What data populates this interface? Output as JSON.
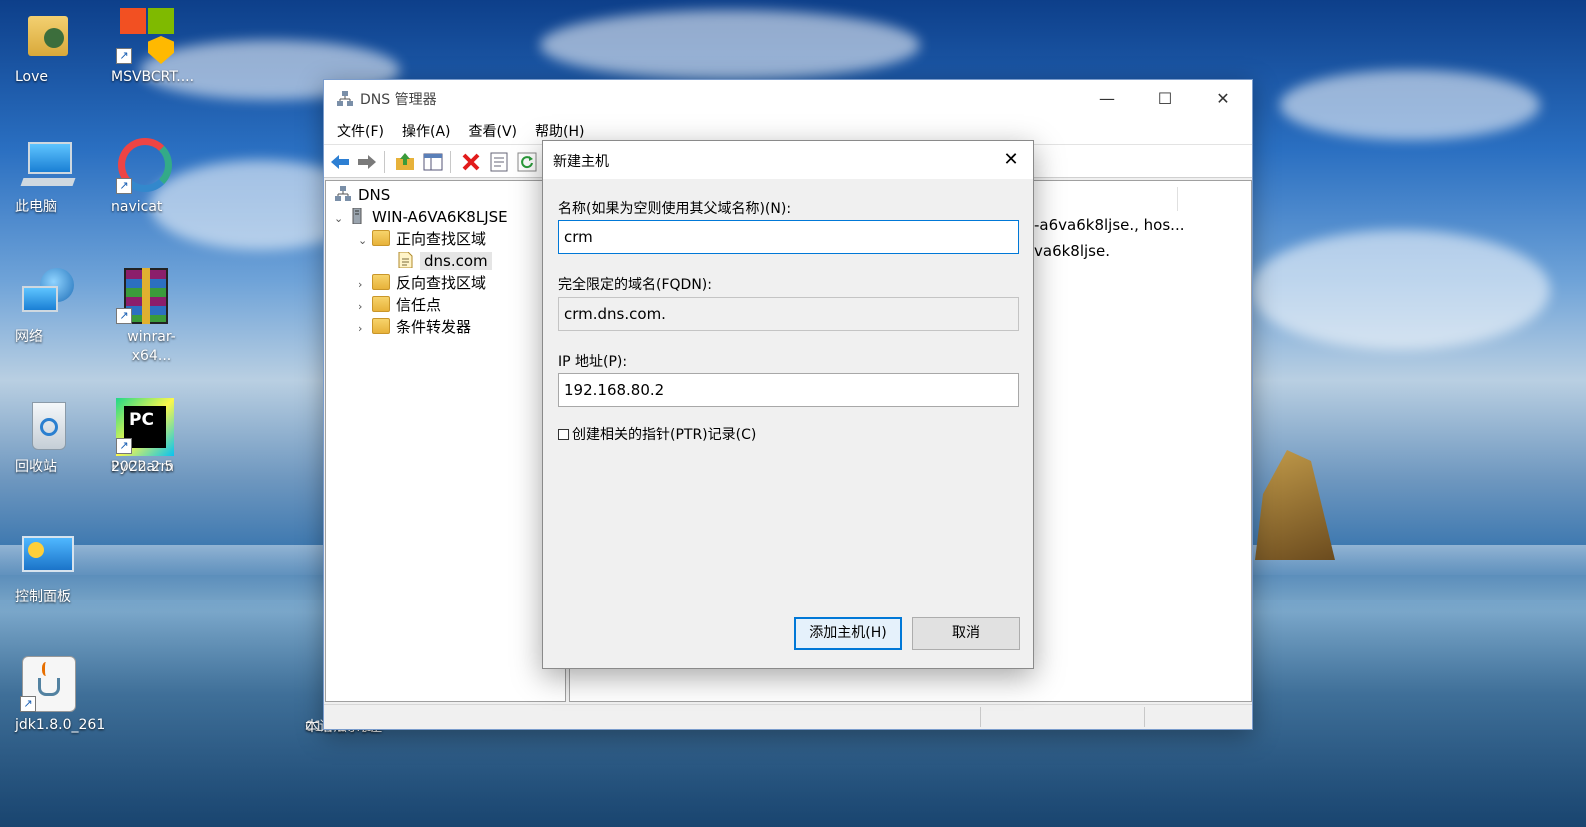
{
  "desktop": {
    "icons": [
      {
        "label": "Love",
        "icon": "user-folder-icon"
      },
      {
        "label": "MSVBCRT....",
        "icon": "msvbcrt-installer-icon"
      },
      {
        "label": "此电脑",
        "icon": "computer-icon"
      },
      {
        "label": "navicat",
        "icon": "navicat-icon"
      },
      {
        "label": "网络",
        "icon": "network-icon"
      },
      {
        "label": "winrar-x64...",
        "icon": "winrar-icon"
      },
      {
        "label": "回收站",
        "icon": "recycle-bin-icon"
      },
      {
        "label": "PyCharm\n2022.2.5",
        "label_line1": "PyCharm",
        "label_line2": "2022.2.5",
        "icon": "pycharm-icon"
      },
      {
        "label": "控制面板",
        "icon": "control-panel-icon"
      },
      {
        "label": "jdk1.8.0_261",
        "icon": "java-icon"
      }
    ],
    "partial_icon_label_line1": "01.入门与基",
    "partial_icon_label_line2": "本语法.md",
    "pycharm_glyph": "PC"
  },
  "window": {
    "title": "DNS 管理器",
    "minimize": "—",
    "maximize": "☐",
    "close": "✕",
    "menu": [
      "文件(F)",
      "操作(A)",
      "查看(V)",
      "帮助(H)"
    ]
  },
  "tree": {
    "root": "DNS",
    "server": "WIN-A6VA6K8LJSE",
    "forward_zone": "正向查找区域",
    "zone": "dns.com",
    "reverse_zone": "反向查找区域",
    "trust_points": "信任点",
    "forwarders": "条件转发器"
  },
  "right_pane": {
    "row1": "-a6va6k8ljse., hos...",
    "row2": "va6k8ljse."
  },
  "dialog": {
    "title": "新建主机",
    "close": "✕",
    "name_label": "名称(如果为空则使用其父域名称)(N):",
    "name_value": "crm",
    "fqdn_label": "完全限定的域名(FQDN):",
    "fqdn_value": "crm.dns.com.",
    "ip_label": "IP 地址(P):",
    "ip_value": "192.168.80.2",
    "ptr_label": "创建相关的指针(PTR)记录(C)",
    "ptr_checked": false,
    "add_button": "添加主机(H)",
    "cancel_button": "取消"
  },
  "colors": {
    "focus_border": "#0078d7",
    "delete_red": "#e21b1b",
    "nav_blue": "#2d7fd3"
  }
}
